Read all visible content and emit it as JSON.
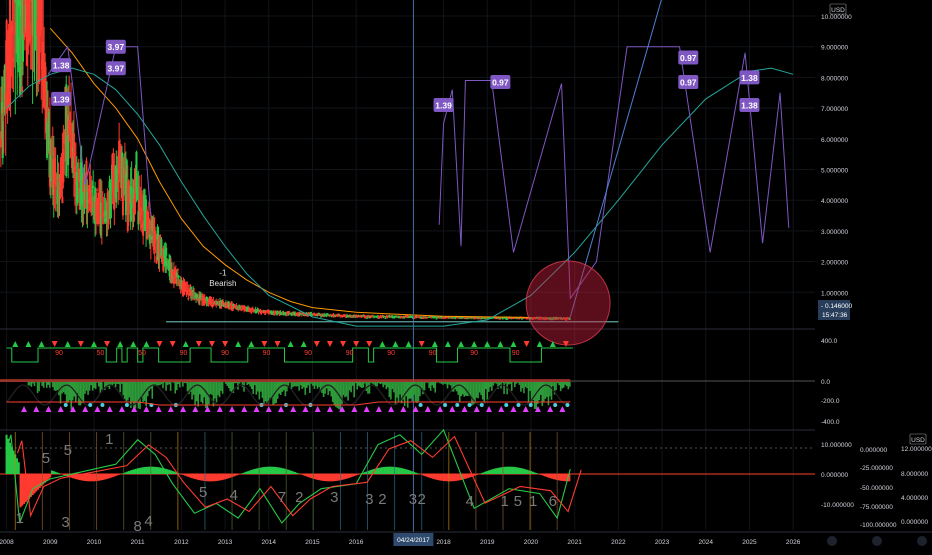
{
  "chart_data": {
    "type": "line",
    "currency": "USD",
    "main_pane": {
      "price_axis_ticks": [
        "10.000000",
        "9.000000",
        "8.000000",
        "7.000000",
        "6.000000",
        "5.000000",
        "4.000000",
        "3.000000",
        "2.000000",
        "1.000000"
      ],
      "last_price": "0.146000",
      "countdown": "15:47:36",
      "pattern_labels": [
        {
          "text": "1.38",
          "x": 2009.25,
          "y": 8.4
        },
        {
          "text": "1.39",
          "x": 2009.25,
          "y": 7.3
        },
        {
          "text": "3.97",
          "x": 2010.5,
          "y": 9.0
        },
        {
          "text": "3.97",
          "x": 2010.5,
          "y": 8.3
        },
        {
          "text": "1.39",
          "x": 2018.0,
          "y": 7.1
        },
        {
          "text": "0.97",
          "x": 2019.3,
          "y": 7.85
        },
        {
          "text": "0.97",
          "x": 2023.6,
          "y": 8.65
        },
        {
          "text": "0.97",
          "x": 2023.6,
          "y": 7.85
        },
        {
          "text": "1.38",
          "x": 2025.0,
          "y": 8.0
        },
        {
          "text": "1.38",
          "x": 2025.0,
          "y": 7.1
        }
      ],
      "annotations": [
        {
          "text": "-1",
          "x": 2012.95,
          "y": 1.55
        },
        {
          "text": "Bearish",
          "x": 2012.95,
          "y": 1.2
        }
      ],
      "price_series": [
        {
          "x": 2007.85,
          "y": 6.2
        },
        {
          "x": 2008.0,
          "y": 8.0
        },
        {
          "x": 2008.2,
          "y": 9.6
        },
        {
          "x": 2008.45,
          "y": 10.4
        },
        {
          "x": 2008.6,
          "y": 10.0
        },
        {
          "x": 2008.8,
          "y": 9.7
        },
        {
          "x": 2009.0,
          "y": 5.5
        },
        {
          "x": 2009.2,
          "y": 4.0
        },
        {
          "x": 2009.4,
          "y": 6.8
        },
        {
          "x": 2009.6,
          "y": 4.8
        },
        {
          "x": 2009.8,
          "y": 4.2
        },
        {
          "x": 2010.0,
          "y": 3.8
        },
        {
          "x": 2010.3,
          "y": 3.6
        },
        {
          "x": 2010.6,
          "y": 5.2
        },
        {
          "x": 2010.8,
          "y": 4.0
        },
        {
          "x": 2011.0,
          "y": 4.4
        },
        {
          "x": 2011.2,
          "y": 3.2
        },
        {
          "x": 2011.5,
          "y": 2.4
        },
        {
          "x": 2011.8,
          "y": 1.6
        },
        {
          "x": 2012.0,
          "y": 1.2
        },
        {
          "x": 2012.3,
          "y": 0.9
        },
        {
          "x": 2012.6,
          "y": 0.7
        },
        {
          "x": 2013.0,
          "y": 0.6
        },
        {
          "x": 2013.5,
          "y": 0.45
        },
        {
          "x": 2014.0,
          "y": 0.35
        },
        {
          "x": 2014.5,
          "y": 0.3
        },
        {
          "x": 2015.0,
          "y": 0.28
        },
        {
          "x": 2015.5,
          "y": 0.25
        },
        {
          "x": 2016.0,
          "y": 0.22
        },
        {
          "x": 2017.0,
          "y": 0.2
        },
        {
          "x": 2018.0,
          "y": 0.18
        },
        {
          "x": 2019.0,
          "y": 0.17
        },
        {
          "x": 2020.0,
          "y": 0.16
        },
        {
          "x": 2020.9,
          "y": 0.146
        }
      ],
      "moving_average_orange": [
        {
          "x": 2009.0,
          "y": 9.6
        },
        {
          "x": 2009.5,
          "y": 8.8
        },
        {
          "x": 2010.0,
          "y": 7.8
        },
        {
          "x": 2010.5,
          "y": 7.0
        },
        {
          "x": 2011.0,
          "y": 6.0
        },
        {
          "x": 2011.5,
          "y": 4.6
        },
        {
          "x": 2012.0,
          "y": 3.4
        },
        {
          "x": 2012.5,
          "y": 2.5
        },
        {
          "x": 2013.0,
          "y": 1.9
        },
        {
          "x": 2013.5,
          "y": 1.4
        },
        {
          "x": 2014.0,
          "y": 1.0
        },
        {
          "x": 2014.5,
          "y": 0.7
        },
        {
          "x": 2015.0,
          "y": 0.5
        },
        {
          "x": 2016.0,
          "y": 0.35
        },
        {
          "x": 2017.0,
          "y": 0.28
        },
        {
          "x": 2018.0,
          "y": 0.22
        },
        {
          "x": 2019.0,
          "y": 0.2
        },
        {
          "x": 2020.0,
          "y": 0.18
        }
      ],
      "regression_curve": [
        {
          "x": 2008.0,
          "y": 7.0
        },
        {
          "x": 2008.5,
          "y": 7.7
        },
        {
          "x": 2009.0,
          "y": 8.1
        },
        {
          "x": 2009.5,
          "y": 8.3
        },
        {
          "x": 2010.0,
          "y": 8.1
        },
        {
          "x": 2010.5,
          "y": 7.6
        },
        {
          "x": 2011.0,
          "y": 6.8
        },
        {
          "x": 2011.5,
          "y": 5.8
        },
        {
          "x": 2012.0,
          "y": 4.6
        },
        {
          "x": 2012.5,
          "y": 3.5
        },
        {
          "x": 2013.0,
          "y": 2.5
        },
        {
          "x": 2013.5,
          "y": 1.6
        },
        {
          "x": 2014.0,
          "y": 0.9
        },
        {
          "x": 2015.0,
          "y": 0.2
        },
        {
          "x": 2016.0,
          "y": -0.3
        },
        {
          "x": 2017.0,
          "y": -0.5
        },
        {
          "x": 2018.0,
          "y": -0.4
        },
        {
          "x": 2019.0,
          "y": 0.1
        },
        {
          "x": 2020.0,
          "y": 0.9
        },
        {
          "x": 2021.0,
          "y": 2.3
        },
        {
          "x": 2022.0,
          "y": 4.0
        },
        {
          "x": 2023.0,
          "y": 5.8
        },
        {
          "x": 2024.0,
          "y": 7.3
        },
        {
          "x": 2025.0,
          "y": 8.2
        },
        {
          "x": 2025.5,
          "y": 8.3
        },
        {
          "x": 2026.0,
          "y": 8.1
        }
      ],
      "projection_zigzag_a": [
        {
          "x": 2017.9,
          "y": 3.2
        },
        {
          "x": 2018.0,
          "y": 6.5
        },
        {
          "x": 2018.2,
          "y": 7.6
        },
        {
          "x": 2018.4,
          "y": 2.5
        },
        {
          "x": 2018.5,
          "y": 7.9
        },
        {
          "x": 2019.1,
          "y": 7.9
        },
        {
          "x": 2019.6,
          "y": 2.3
        },
        {
          "x": 2020.7,
          "y": 7.8
        },
        {
          "x": 2020.9,
          "y": 0.8
        },
        {
          "x": 2021.5,
          "y": 2.0
        },
        {
          "x": 2022.2,
          "y": 9.0
        },
        {
          "x": 2023.4,
          "y": 9.0
        },
        {
          "x": 2024.1,
          "y": 2.3
        },
        {
          "x": 2024.9,
          "y": 8.8
        },
        {
          "x": 2025.3,
          "y": 2.6
        },
        {
          "x": 2025.7,
          "y": 7.5
        },
        {
          "x": 2025.9,
          "y": 3.1
        }
      ],
      "projection_zigzag_b": [
        {
          "x": 2008.95,
          "y": 8.1
        },
        {
          "x": 2009.4,
          "y": 9.0
        },
        {
          "x": 2009.8,
          "y": 4.5
        },
        {
          "x": 2010.5,
          "y": 9.0
        },
        {
          "x": 2011.0,
          "y": 9.0
        },
        {
          "x": 2011.3,
          "y": 3.5
        }
      ]
    },
    "signal_pane": {
      "axis_ticks": [
        "400.0",
        "0.0",
        "-200.0",
        "-400.0"
      ],
      "sell_labels": [
        "90",
        "50",
        "50",
        "90",
        "90",
        "90",
        "90",
        "90",
        "90",
        "90",
        "90",
        "90"
      ]
    },
    "oscillator_pane": {
      "axis_ticks": [
        "10.000000",
        "0.000000",
        "-10.000000"
      ],
      "count_labels": [
        {
          "text": "5",
          "x": 2008.9
        },
        {
          "text": "5",
          "x": 2009.4
        },
        {
          "text": "1",
          "x": 2010.35
        },
        {
          "text": "1",
          "x": 2008.3
        },
        {
          "text": "3",
          "x": 2009.35
        },
        {
          "text": "8",
          "x": 2011.0
        },
        {
          "text": "4",
          "x": 2011.25
        },
        {
          "text": "5",
          "x": 2012.5
        },
        {
          "text": "4",
          "x": 2013.2
        },
        {
          "text": "7",
          "x": 2014.3
        },
        {
          "text": "2",
          "x": 2014.7
        },
        {
          "text": "3",
          "x": 2015.5
        },
        {
          "text": "3",
          "x": 2016.3
        },
        {
          "text": "2",
          "x": 2016.6
        },
        {
          "text": "3",
          "x": 2017.3
        },
        {
          "text": "2",
          "x": 2017.5
        },
        {
          "text": "4",
          "x": 2018.6
        },
        {
          "text": "1",
          "x": 2019.4
        },
        {
          "text": "5",
          "x": 2019.7
        },
        {
          "text": "1",
          "x": 2020.05
        },
        {
          "text": "6",
          "x": 2020.5
        }
      ],
      "oscillator_line": [
        {
          "x": 2008.0,
          "y": 5
        },
        {
          "x": 2008.1,
          "y": 8
        },
        {
          "x": 2008.3,
          "y": -10
        },
        {
          "x": 2008.6,
          "y": -3
        },
        {
          "x": 2009.0,
          "y": -1
        },
        {
          "x": 2010.5,
          "y": 2
        },
        {
          "x": 2011.0,
          "y": 7
        },
        {
          "x": 2011.4,
          "y": 4
        },
        {
          "x": 2011.8,
          "y": -2
        },
        {
          "x": 2012.3,
          "y": -8
        },
        {
          "x": 2012.8,
          "y": -6
        },
        {
          "x": 2013.3,
          "y": -9
        },
        {
          "x": 2013.8,
          "y": -3
        },
        {
          "x": 2014.3,
          "y": -10
        },
        {
          "x": 2014.7,
          "y": -6
        },
        {
          "x": 2015.2,
          "y": -3
        },
        {
          "x": 2016.0,
          "y": -2
        },
        {
          "x": 2016.5,
          "y": 6
        },
        {
          "x": 2017.0,
          "y": 8
        },
        {
          "x": 2017.5,
          "y": 4
        },
        {
          "x": 2018.0,
          "y": 9
        },
        {
          "x": 2018.7,
          "y": -7
        },
        {
          "x": 2019.5,
          "y": -3
        },
        {
          "x": 2020.2,
          "y": -4
        },
        {
          "x": 2020.6,
          "y": -9
        },
        {
          "x": 2020.9,
          "y": 1
        }
      ],
      "secondary_axis_ticks": [
        "12.000000",
        "8.000000",
        "4.000000",
        "0.000000"
      ],
      "secondary_axis_negative_ticks": [
        "0.000000",
        "-25.000000",
        "-50.000000",
        "-75.000000",
        "-100.000000"
      ]
    },
    "time_axis": {
      "labels": [
        "2008",
        "2009",
        "2010",
        "2011",
        "2012",
        "2013",
        "2014",
        "2015",
        "2016",
        "2018",
        "2019",
        "2020",
        "2021",
        "2022",
        "2023",
        "2024",
        "2025",
        "2026"
      ],
      "crosshair_date": "04/24/2017",
      "xlim": [
        2007.85,
        2026.5
      ]
    },
    "ylim_main": [
      0,
      10
    ]
  },
  "colors": {
    "background": "#000000",
    "bull": "#26c947",
    "bear": "#ff3b30",
    "ma_orange": "#ff9800",
    "regression": "#26a69a",
    "projection": "#7e57c2",
    "label_bg": "#7e57c2",
    "crosshair": "#4a6fa5",
    "price_tag": "#283d5a"
  }
}
